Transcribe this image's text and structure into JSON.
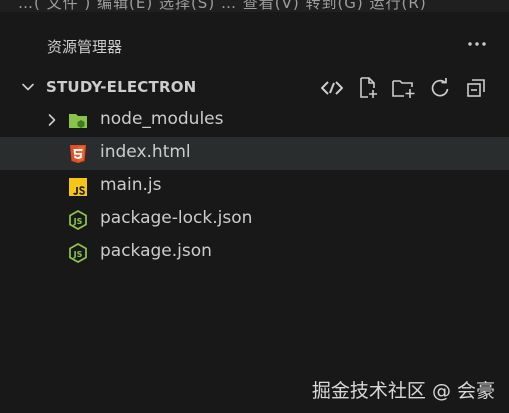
{
  "menu_fragment": "…( 文件 ) 编辑(E) 选择(S) … 查看(V) 转到(G) 运行(R)",
  "explorer": {
    "title": "资源管理器",
    "more_icon": "ellipsis-icon"
  },
  "section": {
    "title": "STUDY-ELECTRON",
    "actions": [
      {
        "name": "new-file",
        "icon": "code-sync-icon"
      },
      {
        "name": "new-file",
        "icon": "new-file-icon"
      },
      {
        "name": "new-folder",
        "icon": "new-folder-icon"
      },
      {
        "name": "refresh",
        "icon": "refresh-icon"
      },
      {
        "name": "collapse",
        "icon": "collapse-all-icon"
      }
    ]
  },
  "tree": {
    "items": [
      {
        "label": "node_modules",
        "icon": "node-folder-icon",
        "type": "folder"
      },
      {
        "label": "index.html",
        "icon": "html5-icon",
        "type": "file",
        "selected": true
      },
      {
        "label": "main.js",
        "icon": "js-file-icon",
        "type": "file"
      },
      {
        "label": "package-lock.json",
        "icon": "nodejs-icon",
        "type": "file"
      },
      {
        "label": "package.json",
        "icon": "nodejs-icon",
        "type": "file"
      }
    ]
  },
  "watermark": "掘金技术社区 @ 会豪",
  "colors": {
    "background": "#181818",
    "selected_row": "#2a2d2e",
    "text": "#cccccc",
    "html_orange": "#e44d26",
    "js_yellow": "#f5c518",
    "node_green": "#8cc84b"
  }
}
